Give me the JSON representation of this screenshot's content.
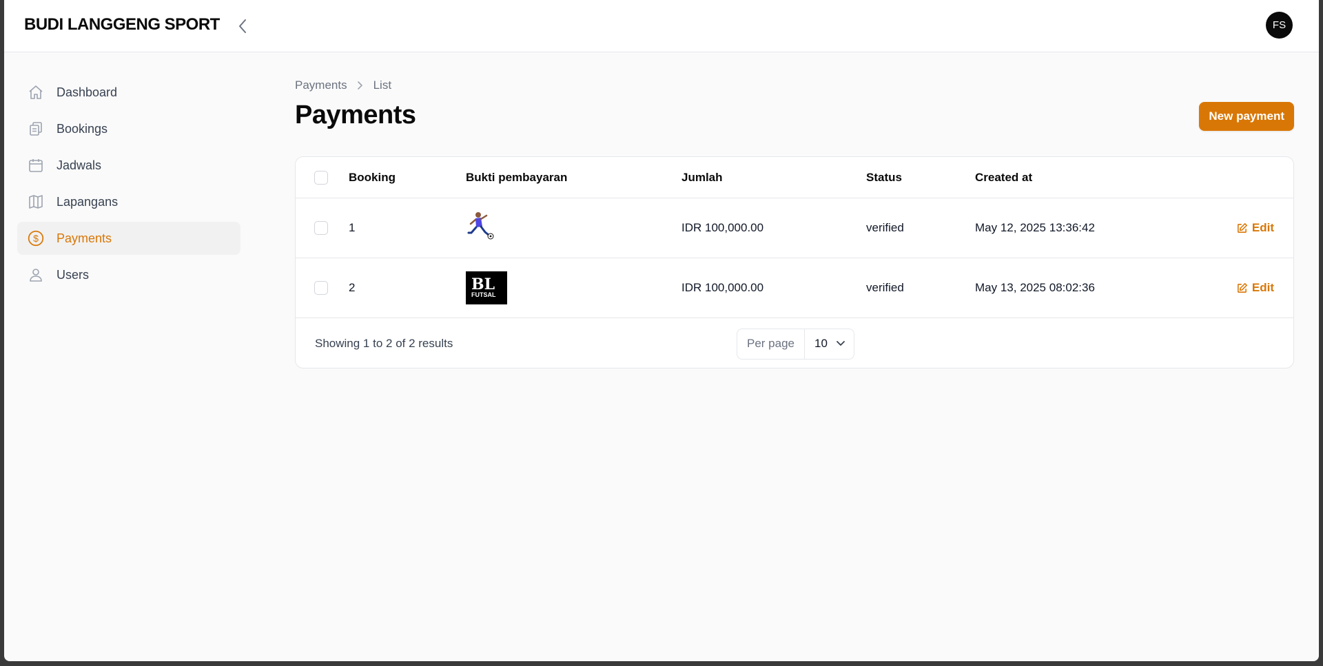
{
  "app": {
    "brand": "BUDI LANGGENG SPORT",
    "user_initials": "FS",
    "accent_color": "#d97706"
  },
  "sidebar": {
    "items": [
      {
        "label": "Dashboard",
        "icon": "home-icon"
      },
      {
        "label": "Bookings",
        "icon": "clipboard-icon"
      },
      {
        "label": "Jadwals",
        "icon": "calendar-icon"
      },
      {
        "label": "Lapangans",
        "icon": "map-icon"
      },
      {
        "label": "Payments",
        "icon": "dollar-icon",
        "active": true
      },
      {
        "label": "Users",
        "icon": "user-icon"
      }
    ]
  },
  "breadcrumb": {
    "first": "Payments",
    "second": "List"
  },
  "page": {
    "title": "Payments",
    "new_button": "New payment"
  },
  "table": {
    "headers": {
      "booking": "Booking",
      "bukti": "Bukti pembayaran",
      "jumlah": "Jumlah",
      "status": "Status",
      "created": "Created at"
    },
    "rows": [
      {
        "booking": "1",
        "bukti": "soccer-player-image",
        "jumlah": "IDR 100,000.00",
        "status": "verified",
        "created": "May 12, 2025 13:36:42",
        "action": "Edit"
      },
      {
        "booking": "2",
        "bukti_text_big": "BL",
        "bukti_text_small": "FUTSAL",
        "jumlah": "IDR 100,000.00",
        "status": "verified",
        "created": "May 13, 2025 08:02:36",
        "action": "Edit"
      }
    ],
    "footer": {
      "summary": "Showing 1 to 2 of 2 results",
      "per_page_label": "Per page",
      "per_page_value": "10"
    }
  }
}
